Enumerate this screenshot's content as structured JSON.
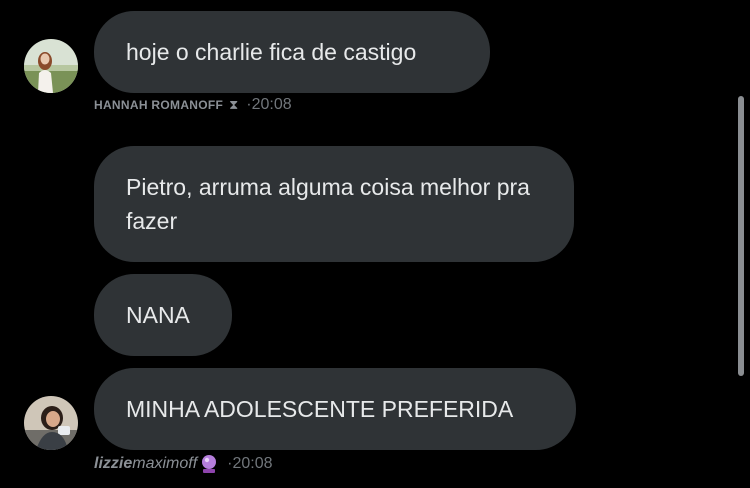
{
  "messages": [
    {
      "text": "hoje o charlie fica de castigo"
    },
    {
      "text": "Pietro, arruma alguma coisa melhor pra fazer"
    },
    {
      "text": "NANA"
    },
    {
      "text": "MINHA ADOLESCENTE PREFERIDA"
    }
  ],
  "senders": [
    {
      "name": "HANNAH ROMANOFF",
      "badge": "⧗",
      "sep": "·",
      "time": "20:08"
    },
    {
      "name_bold": "lizzie",
      "name_rest": "maximoff",
      "badge_icon": "crystal-ball-icon",
      "sep": "·",
      "time": "20:08"
    }
  ],
  "colors": {
    "background": "#000000",
    "bubble": "#2f3336",
    "text": "#e7e9ea",
    "meta": "#71767b"
  }
}
